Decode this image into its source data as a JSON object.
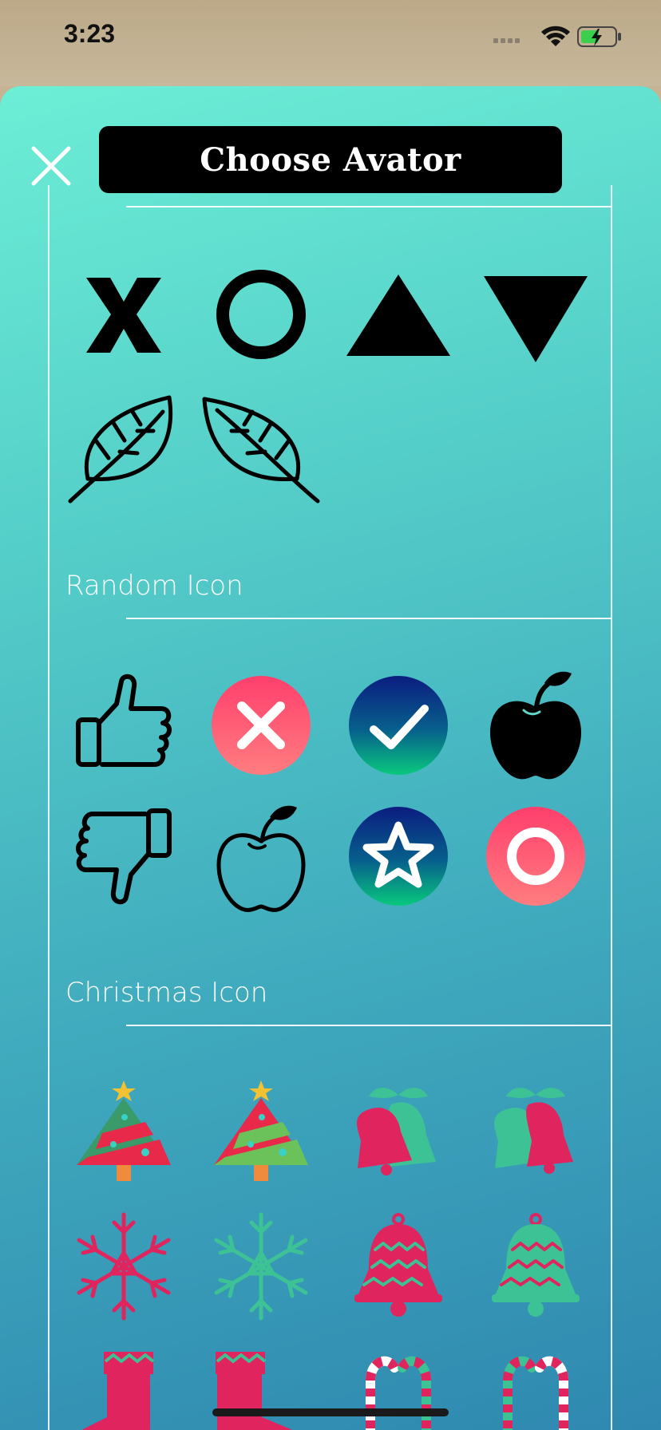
{
  "status": {
    "time": "3:23"
  },
  "header": {
    "title": "Choose Avator"
  },
  "sections": [
    {
      "title": ""
    },
    {
      "title": "Random Icon"
    },
    {
      "title": "Christmas Icon"
    }
  ],
  "icons": {
    "shapes": [
      "x-mark-icon",
      "circle-outline-icon",
      "triangle-up-icon",
      "triangle-down-icon",
      "leaf-right-icon",
      "leaf-left-icon"
    ],
    "random": [
      "thumbs-up-icon",
      "red-x-circle-icon",
      "blue-check-circle-icon",
      "apple-filled-icon",
      "thumbs-down-icon",
      "apple-outline-icon",
      "blue-star-circle-icon",
      "red-ring-circle-icon"
    ],
    "christmas": [
      "christmas-tree-red-icon",
      "christmas-tree-green-icon",
      "bells-red-front-icon",
      "bells-green-front-icon",
      "snowflake-red-icon",
      "snowflake-green-icon",
      "bell-red-zigzag-icon",
      "bell-green-zigzag-icon",
      "stocking-icon",
      "stocking-icon",
      "candy-cane-icon",
      "candy-cane-icon"
    ]
  },
  "colors": {
    "sheet_top": "#6ceed6",
    "sheet_bottom": "#2f88b0",
    "festive_red": "#e0245e",
    "festive_green": "#3cc295"
  }
}
